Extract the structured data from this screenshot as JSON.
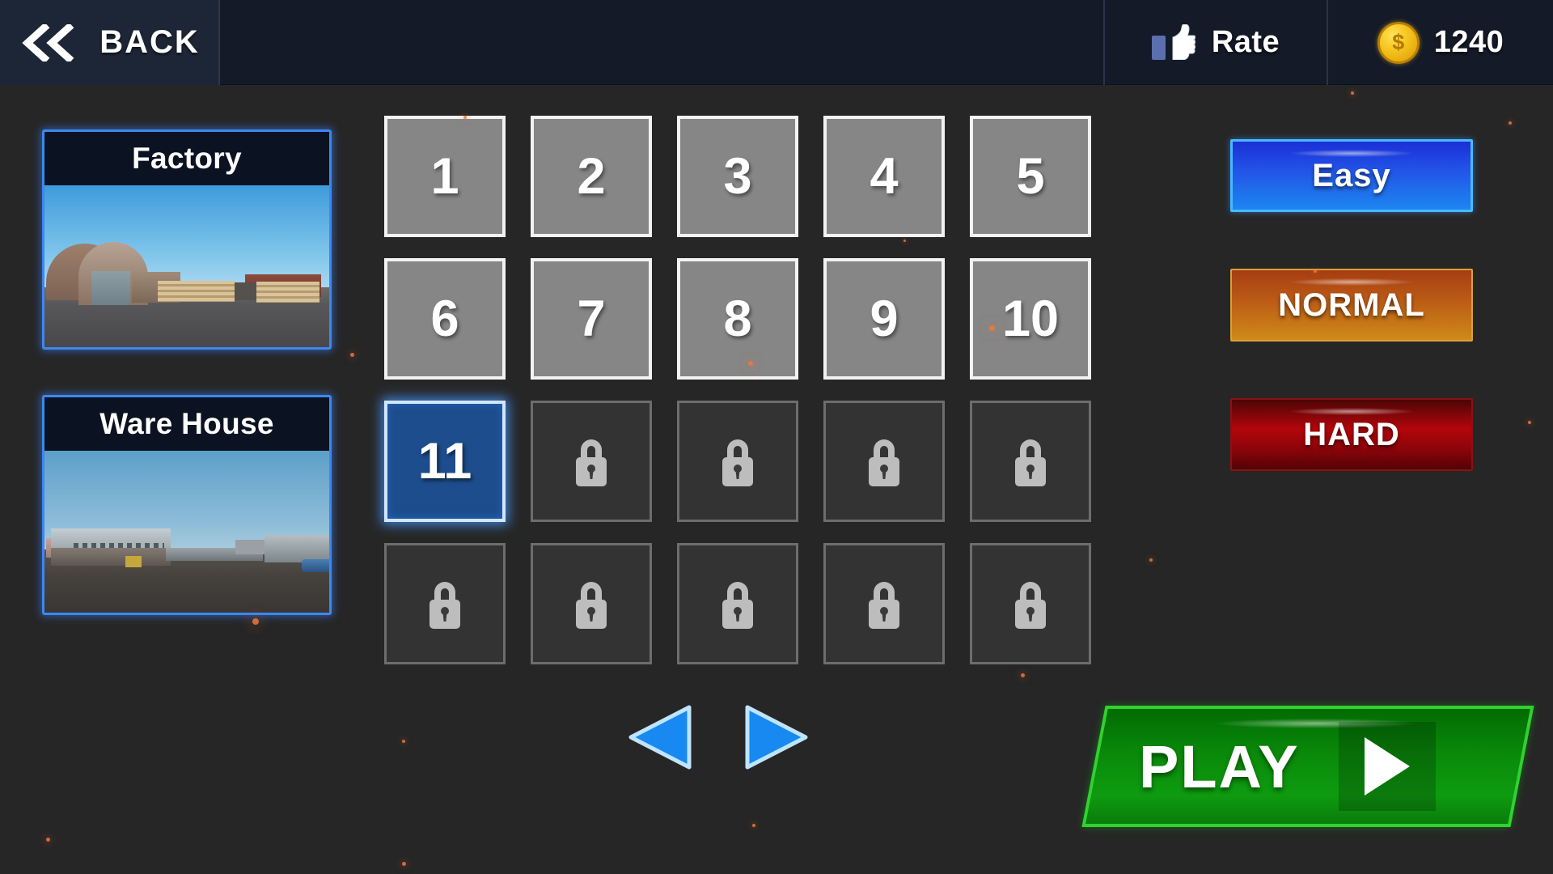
{
  "header": {
    "back_label": "BACK",
    "back_icon": "double-chevron-left-icon",
    "rate_label": "Rate",
    "rate_icon": "thumbs-up-icon",
    "coin_icon": "gold-coin-icon",
    "coin_amount": "1240",
    "bar_color": "#141a28"
  },
  "maps": [
    {
      "title": "Factory",
      "selected": true
    },
    {
      "title": "Ware House",
      "selected": true
    }
  ],
  "levels": {
    "tiles": [
      {
        "label": "1",
        "state": "unlocked"
      },
      {
        "label": "2",
        "state": "unlocked"
      },
      {
        "label": "3",
        "state": "unlocked"
      },
      {
        "label": "4",
        "state": "unlocked"
      },
      {
        "label": "5",
        "state": "unlocked"
      },
      {
        "label": "6",
        "state": "unlocked"
      },
      {
        "label": "7",
        "state": "unlocked"
      },
      {
        "label": "8",
        "state": "unlocked"
      },
      {
        "label": "9",
        "state": "unlocked"
      },
      {
        "label": "10",
        "state": "unlocked"
      },
      {
        "label": "11",
        "state": "selected"
      },
      {
        "label": "",
        "state": "locked"
      },
      {
        "label": "",
        "state": "locked"
      },
      {
        "label": "",
        "state": "locked"
      },
      {
        "label": "",
        "state": "locked"
      },
      {
        "label": "",
        "state": "locked"
      },
      {
        "label": "",
        "state": "locked"
      },
      {
        "label": "",
        "state": "locked"
      },
      {
        "label": "",
        "state": "locked"
      },
      {
        "label": "",
        "state": "locked"
      }
    ],
    "lock_icon": "padlock-icon",
    "selected_level": "11",
    "unlocked_color": "#868686",
    "locked_color": "#333333",
    "selected_color": "#1d4d8c"
  },
  "pager": {
    "prev_icon": "triangle-left-icon",
    "next_icon": "triangle-right-icon",
    "color": "#1789f0"
  },
  "difficulty": {
    "options": [
      {
        "label": "Easy",
        "color": "#2250e6",
        "selected": true
      },
      {
        "label": "NORMAL",
        "color": "#bb5a16",
        "selected": false
      },
      {
        "label": "HARD",
        "color": "#b3060b",
        "selected": false
      }
    ]
  },
  "play": {
    "label": "PLAY",
    "icon": "play-triangle-icon",
    "color": "#0e9b10"
  }
}
